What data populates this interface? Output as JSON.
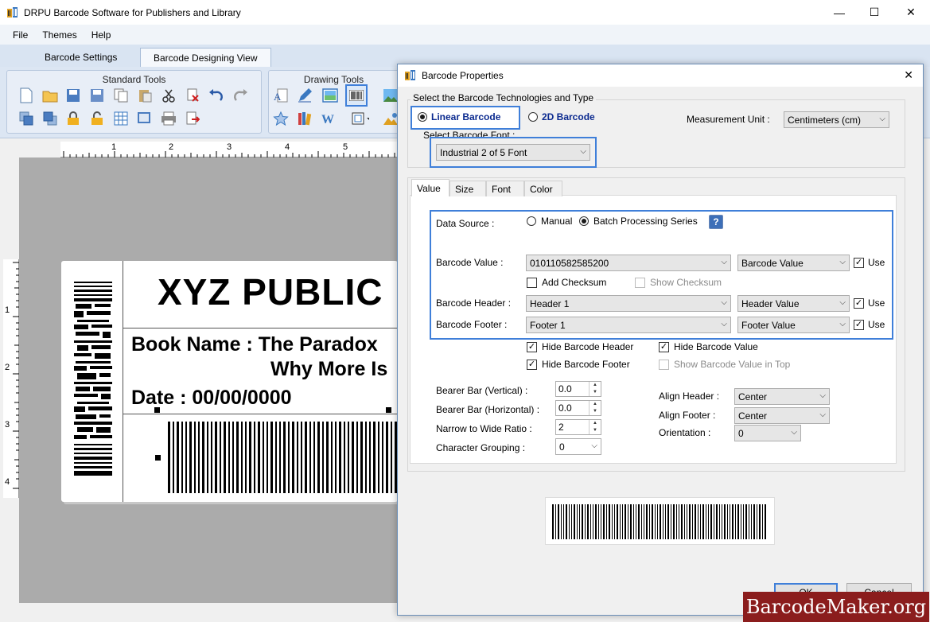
{
  "app": {
    "title": "DRPU Barcode Software for Publishers and Library"
  },
  "window_controls": {
    "minimize": "—",
    "maximize": "☐",
    "close": "✕"
  },
  "menu": {
    "file": "File",
    "themes": "Themes",
    "help": "Help"
  },
  "main_tabs": [
    {
      "label": "Barcode Settings"
    },
    {
      "label": "Barcode Designing View"
    }
  ],
  "ribbon": {
    "standard_tools": "Standard Tools",
    "drawing_tools": "Drawing Tools"
  },
  "ruler": {
    "h": [
      "1",
      "2",
      "3",
      "4",
      "5"
    ],
    "v": [
      "1",
      "2",
      "3",
      "4"
    ]
  },
  "label_preview": {
    "company": "XYZ PUBLIC",
    "book_line1": "Book Name : The Paradox",
    "book_line2": "Why More Is",
    "date": "Date : 00/00/0000"
  },
  "dialog": {
    "title": "Barcode Properties",
    "close": "✕",
    "tech_legend": "Select the Barcode Technologies and Type",
    "linear": "Linear Barcode",
    "twod": "2D Barcode",
    "font_label": "Select Barcode Font :",
    "font_value": "Industrial 2 of 5 Font",
    "measurement_label": "Measurement Unit :",
    "measurement_value": "Centimeters (cm)",
    "tabs": [
      "Value",
      "Size",
      "Font",
      "Color"
    ],
    "data_source_label": "Data Source :",
    "manual": "Manual",
    "batch": "Batch Processing Series",
    "help_icon": "?",
    "barcode_value_label": "Barcode Value :",
    "barcode_value": "010110582585200",
    "barcode_value_src": "Barcode Value",
    "use": "Use",
    "add_checksum": "Add Checksum",
    "show_checksum": "Show Checksum",
    "header_label": "Barcode Header :",
    "header_value": "Header 1",
    "header_src": "Header Value",
    "footer_label": "Barcode Footer :",
    "footer_value": "Footer 1",
    "footer_src": "Footer Value",
    "hide_header": "Hide Barcode Header",
    "hide_value": "Hide Barcode Value",
    "hide_footer": "Hide Barcode Footer",
    "show_value_top": "Show Barcode Value in Top",
    "bearer_v_label": "Bearer Bar (Vertical) :",
    "bearer_v": "0.0",
    "bearer_h_label": "Bearer Bar (Horizontal) :",
    "bearer_h": "0.0",
    "ratio_label": "Narrow to Wide Ratio :",
    "ratio": "2",
    "grouping_label": "Character Grouping :",
    "grouping": "0",
    "align_header_label": "Align Header :",
    "align_header": "Center",
    "align_footer_label": "Align Footer :",
    "align_footer": "Center",
    "orientation_label": "Orientation :",
    "orientation": "0",
    "ok": "OK",
    "cancel": "Cancel"
  },
  "watermark": "BarcodeMaker.org",
  "colors": {
    "highlight": "#3f7fd9",
    "linear_text": "#0b2a8f",
    "watermark_bg": "#8b1d1d"
  }
}
